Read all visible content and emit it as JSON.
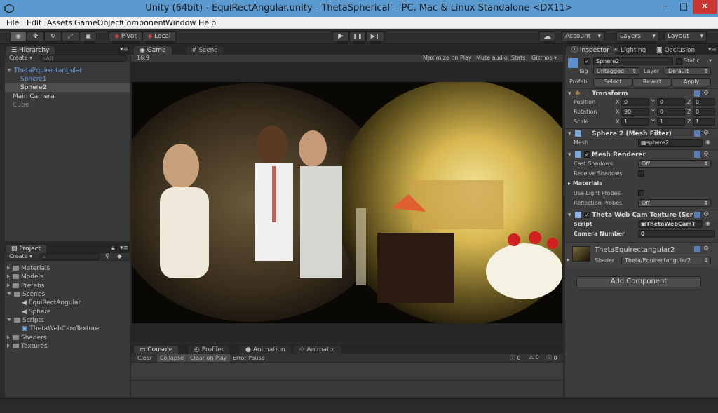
{
  "window": {
    "title": "Unity (64bit) - EquiRectAngular.unity - ThetaSpherical' - PC, Mac & Linux Standalone <DX11>",
    "minimize": "─",
    "maximize": "□",
    "close": "✕"
  },
  "menu": [
    "File",
    "Edit",
    "Assets",
    "GameObject",
    "Component",
    "Window",
    "Help"
  ],
  "toolbar": {
    "pivot": "Pivot",
    "local": "Local",
    "play": "▶",
    "pause": "❚❚",
    "step": "▶❙",
    "cloud": "☁",
    "account": "Account",
    "layers": "Layers",
    "layout": "Layout"
  },
  "hierarchy": {
    "tab": "Hierarchy",
    "create": "Create",
    "search_placeholder": "All",
    "items": [
      "ThetaEquirectangular",
      "Sphere1",
      "Sphere2",
      "Main Camera",
      "Cube"
    ]
  },
  "game": {
    "tab_game": "Game",
    "tab_scene": "Scene",
    "aspect": "16:9",
    "options": [
      "Maximize on Play",
      "Mute audio",
      "Stats",
      "Gizmos"
    ]
  },
  "project": {
    "tab": "Project",
    "create": "Create",
    "items": [
      {
        "label": "Materials",
        "type": "folder"
      },
      {
        "label": "Models",
        "type": "folder"
      },
      {
        "label": "Prefabs",
        "type": "folder"
      },
      {
        "label": "Scenes",
        "type": "folder-open"
      },
      {
        "label": "EquiRectAngular",
        "type": "scene"
      },
      {
        "label": "Sphere",
        "type": "scene"
      },
      {
        "label": "Scripts",
        "type": "folder-open"
      },
      {
        "label": "ThetaWebCamTexture",
        "type": "script"
      },
      {
        "label": "Shaders",
        "type": "folder"
      },
      {
        "label": "Textures",
        "type": "folder"
      }
    ]
  },
  "console": {
    "tabs": [
      "Console",
      "Profiler",
      "Animation",
      "Animator"
    ],
    "buttons": [
      "Clear",
      "Collapse",
      "Clear on Play",
      "Error Pause"
    ],
    "counts": [
      "0",
      "0",
      "0"
    ]
  },
  "inspector": {
    "tabs": [
      "Inspector",
      "Lighting",
      "Occlusion"
    ],
    "object_name": "Sphere2",
    "static": "Static",
    "tag_label": "Tag",
    "tag_value": "Untagged",
    "layer_label": "Layer",
    "layer_value": "Default",
    "prefab_label": "Prefab",
    "prefab_buttons": [
      "Select",
      "Revert",
      "Apply"
    ],
    "transform": {
      "title": "Transform",
      "rows": [
        {
          "label": "Position",
          "x": "0",
          "y": "0",
          "z": "0"
        },
        {
          "label": "Rotation",
          "x": "90",
          "y": "0",
          "z": "0"
        },
        {
          "label": "Scale",
          "x": "1",
          "y": "1",
          "z": "1"
        }
      ],
      "axis": [
        "X",
        "Y",
        "Z"
      ]
    },
    "mesh_filter": {
      "title": "Sphere 2 (Mesh Filter)",
      "mesh_label": "Mesh",
      "mesh_value": "sphere2"
    },
    "mesh_renderer": {
      "title": "Mesh Renderer",
      "cast_shadows": "Cast Shadows",
      "cast_value": "Off",
      "receive_shadows": "Receive Shadows",
      "materials": "Materials",
      "light_probes": "Use Light Probes",
      "reflection": "Reflection Probes",
      "reflection_value": "Off"
    },
    "script_comp": {
      "title": "Theta Web Cam Texture (Scr",
      "script_label": "Script",
      "script_value": "ThetaWebCamT",
      "camera_label": "Camera Number",
      "camera_value": "0"
    },
    "material": {
      "name": "ThetaEquirectangular2",
      "shader_label": "Shader",
      "shader_value": "Theta/Equirectangular2"
    },
    "add_component": "Add Component"
  }
}
